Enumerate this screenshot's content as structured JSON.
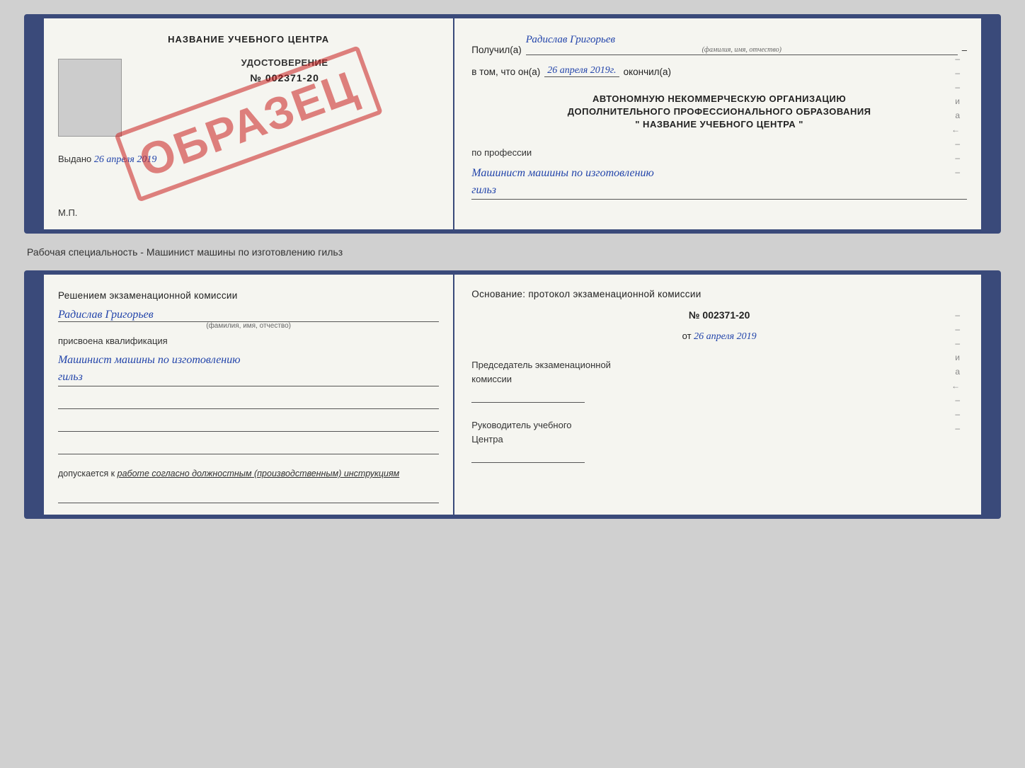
{
  "doc1": {
    "left": {
      "title": "НАЗВАНИЕ УЧЕБНОГО ЦЕНТРА",
      "stamp": "ОБРАЗЕЦ",
      "udostoverenie": "УДОСТОВЕРЕНИЕ",
      "number": "№ 002371-20",
      "vydano_label": "Выдано",
      "vydano_date": "26 апреля 2019",
      "mp": "М.П."
    },
    "right": {
      "poluchil_label": "Получил(а)",
      "recipient_name": "Радислав Григорьев",
      "recipient_sub": "(фамилия, имя, отчество)",
      "vtom_label": "в том, что он(а)",
      "vtom_date": "26 апреля 2019г.",
      "okoncil_label": "окончил(а)",
      "org_line1": "АВТОНОМНУЮ НЕКОММЕРЧЕСКУЮ ОРГАНИЗАЦИЮ",
      "org_line2": "ДОПОЛНИТЕЛЬНОГО ПРОФЕССИОНАЛЬНОГО ОБРАЗОВАНИЯ",
      "org_name": "\"  НАЗВАНИЕ УЧЕБНОГО ЦЕНТРА  \"",
      "po_professii": "по профессии",
      "profession1": "Машинист машины по изготовлению",
      "profession2": "гильз",
      "dashes": [
        "-",
        "-",
        "-",
        "и",
        "а",
        "←",
        "-",
        "-",
        "-"
      ]
    }
  },
  "between_label": "Рабочая специальность - Машинист машины по изготовлению гильз",
  "doc2": {
    "left": {
      "heading": "Решением  экзаменационной  комиссии",
      "name": "Радислав Григорьев",
      "name_sub": "(фамилия, имя, отчество)",
      "prisvoena": "присвоена квалификация",
      "qualification1": "Машинист  машины  по  изготовлению",
      "qualification2": "гильз",
      "dopuskaetsya_prefix": "допускается к",
      "dopuskaetsya_text": "работе согласно должностным (производственным) инструкциям"
    },
    "right": {
      "osnovanie": "Основание: протокол экзаменационной  комиссии",
      "number": "№  002371-20",
      "ot_label": "от",
      "date": "26 апреля 2019",
      "predsedatel_line1": "Председатель экзаменационной",
      "predsedatel_line2": "комиссии",
      "rukovoditel_line1": "Руководитель учебного",
      "rukovoditel_line2": "Центра",
      "dashes": [
        "-",
        "-",
        "-",
        "и",
        "а",
        "←",
        "-",
        "-",
        "-"
      ]
    }
  }
}
